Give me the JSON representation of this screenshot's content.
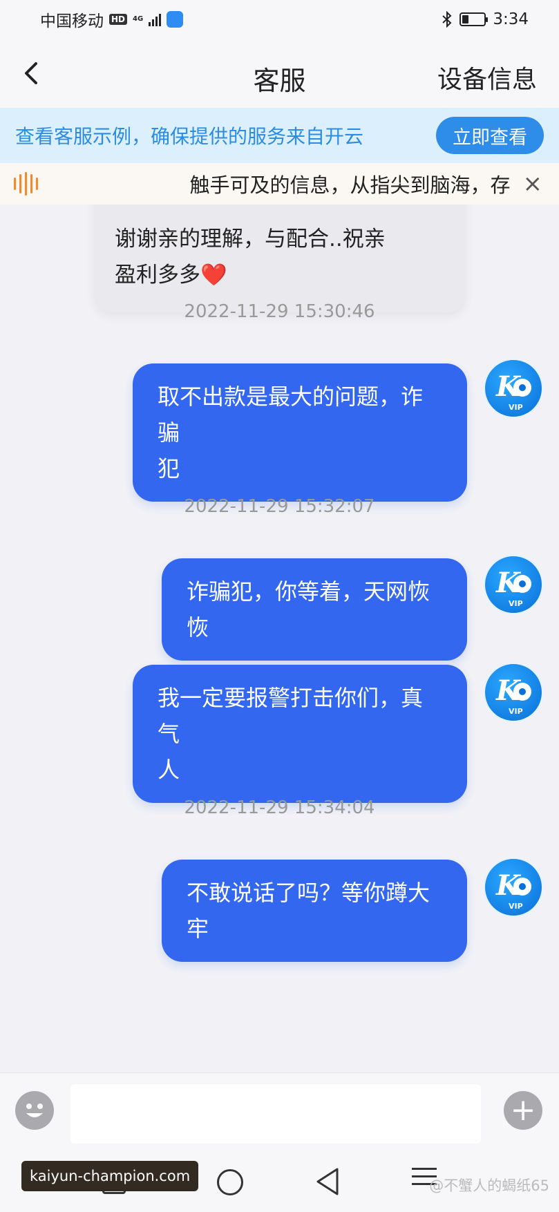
{
  "status_bar": {
    "carrier": "中国移动",
    "hd": "HD",
    "network": "4G",
    "time": "3:34",
    "battery_level": 0.25
  },
  "header": {
    "back_icon": "chevron-left-icon",
    "title": "客服",
    "device_info": "设备信息"
  },
  "banner": {
    "text": "查看客服示例，确保提供的服务来自开云",
    "button": "立即查看"
  },
  "marquee": {
    "icon": "speaker-icon",
    "text": "触手可及的信息，从指尖到脑海，存",
    "close": "×"
  },
  "chat": {
    "received_message": {
      "line1": "谢谢亲的理解，与配合..祝亲",
      "line2": "盈利多多",
      "emoji": "❤️"
    },
    "messages": [
      {
        "timestamp": "2022-11-29 15:30:46",
        "line1": "取不出款是最大的问题，诈骗",
        "line2": "犯"
      },
      {
        "timestamp": "2022-11-29 15:32:07",
        "line1": "诈骗犯，你等着，天网恢恢",
        "line2": ""
      },
      {
        "timestamp": "",
        "line1": "我一定要报警打击你们，真气",
        "line2": "人"
      },
      {
        "timestamp": "2022-11-29 15:34:04",
        "line1": "不敢说话了吗？等你蹲大牢",
        "line2": ""
      }
    ],
    "avatar_text": "VIP"
  },
  "input_bar": {
    "emoji_icon": "emoji-icon",
    "plus_icon": "plus-icon",
    "plus": "+"
  },
  "watermarks": {
    "domain": "kaiyun-champion.com",
    "author": "@不蟹人的蝎纸65"
  },
  "colors": {
    "bubble": "#3367f0",
    "banner_bg": "#dceffd",
    "banner_text": "#2a8ce3",
    "marquee_icon": "#f08a2a"
  }
}
